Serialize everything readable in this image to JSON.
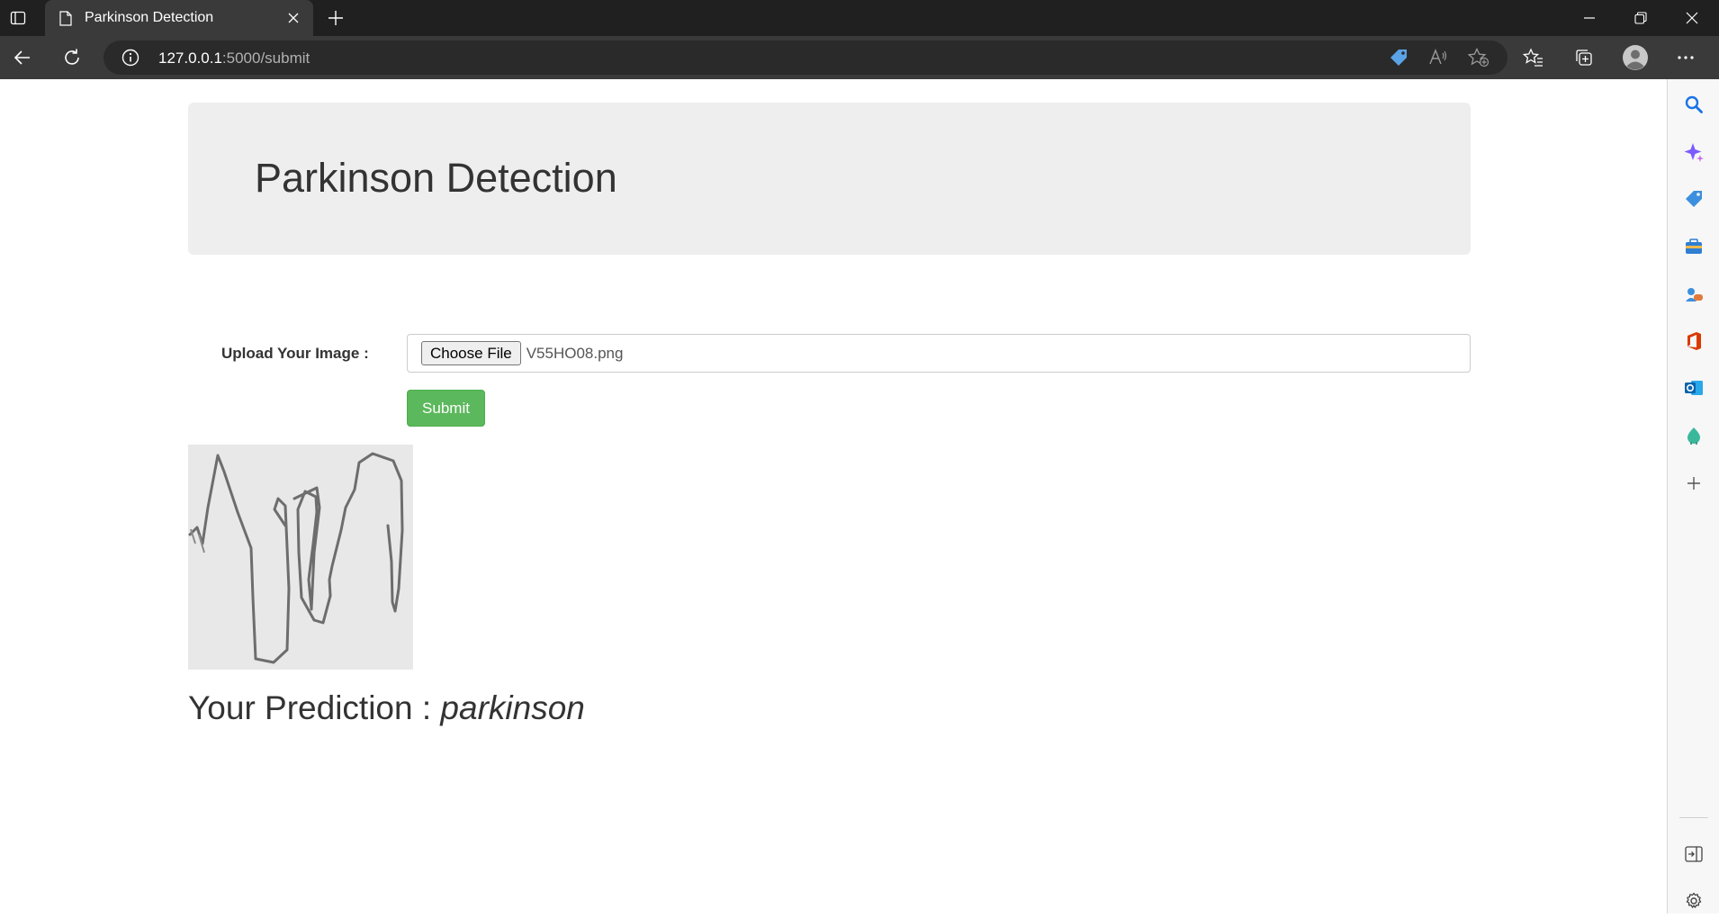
{
  "browser": {
    "tab_title": "Parkinson Detection",
    "url_host": "127.0.0.1",
    "url_rest": ":5000/submit"
  },
  "page": {
    "heading": "Parkinson Detection",
    "upload_label": "Upload Your Image :",
    "choose_file_label": "Choose File",
    "file_name": "V55HO08.png",
    "submit_label": "Submit",
    "prediction_prefix": "Your Prediction : ",
    "prediction_value": "parkinson"
  },
  "colors": {
    "submit_green": "#5cb85c",
    "jumbotron_bg": "#eeeeee",
    "browser_chrome": "#3a3a3a"
  },
  "icons": {
    "sidebar": [
      "search-icon",
      "copilot-icon",
      "shopping-tag-icon",
      "tools-icon",
      "games-icon",
      "office-icon",
      "outlook-icon",
      "drop-icon",
      "add-icon",
      "hide-sidebar-icon",
      "settings-icon"
    ],
    "toolbar": [
      "back-icon",
      "refresh-icon",
      "site-info-icon",
      "shopping-tag-icon",
      "read-aloud-icon",
      "add-favorite-icon",
      "favorites-icon",
      "collections-icon",
      "profile-icon",
      "more-icon"
    ]
  }
}
